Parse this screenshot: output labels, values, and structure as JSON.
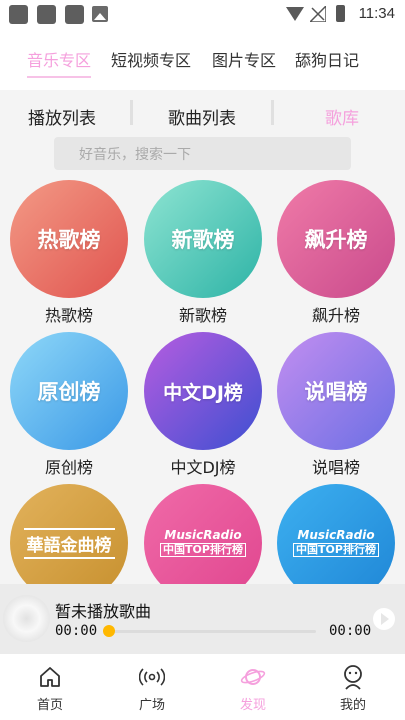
{
  "status_bar": {
    "time": "11:34"
  },
  "top_tabs": [
    {
      "label": "音乐专区",
      "active": true
    },
    {
      "label": "短视频专区",
      "active": false
    },
    {
      "label": "图片专区",
      "active": false
    },
    {
      "label": "舔狗日记",
      "active": false
    }
  ],
  "sub_tabs": [
    {
      "label": "播放列表",
      "active": false
    },
    {
      "label": "歌曲列表",
      "active": false
    },
    {
      "label": "歌库",
      "active": true
    }
  ],
  "search": {
    "placeholder": "好音乐，搜索一下"
  },
  "charts": [
    {
      "circle_text": "热歌榜",
      "label": "热歌榜",
      "gradient": [
        "#f39a86",
        "#e0544f"
      ]
    },
    {
      "circle_text": "新歌榜",
      "label": "新歌榜",
      "gradient": [
        "#8ee4d2",
        "#2db3a6"
      ]
    },
    {
      "circle_text": "飙升榜",
      "label": "飙升榜",
      "gradient": [
        "#f07ba8",
        "#c94a8c"
      ]
    },
    {
      "circle_text": "原创榜",
      "label": "原创榜",
      "gradient": [
        "#8fd8f8",
        "#3a98e6"
      ]
    },
    {
      "circle_text": "中文DJ榜",
      "label": "中文DJ榜",
      "gradient": [
        "#b75de0",
        "#3d4fd1"
      ]
    },
    {
      "circle_text": "说唱榜",
      "label": "说唱榜",
      "gradient": [
        "#c38ef0",
        "#6b6fe4"
      ]
    },
    {
      "circle_text": "華語金曲榜",
      "label": "",
      "gradient": [
        "#e2b25c",
        "#c7902e"
      ]
    },
    {
      "circle_text_a": "MusicRadio",
      "circle_text_b": "中国TOP排行榜",
      "label": "",
      "gradient": [
        "#f06aa8",
        "#e0468f"
      ]
    },
    {
      "circle_text_a": "MusicRadio",
      "circle_text_b": "中国TOP排行榜",
      "label": "",
      "gradient": [
        "#3db0f0",
        "#1f86d6"
      ]
    }
  ],
  "player": {
    "song": "暂未播放歌曲",
    "time_current": "00:00",
    "time_total": "00:00",
    "progress": 0
  },
  "bottom_nav": [
    {
      "label": "首页",
      "icon": "home-icon",
      "active": false
    },
    {
      "label": "广场",
      "icon": "broadcast-icon",
      "active": false
    },
    {
      "label": "发现",
      "icon": "planet-icon",
      "active": true
    },
    {
      "label": "我的",
      "icon": "user-icon",
      "active": false
    }
  ],
  "colors": {
    "accent": "#f5a0dd",
    "progress_knob": "#ffb800"
  }
}
